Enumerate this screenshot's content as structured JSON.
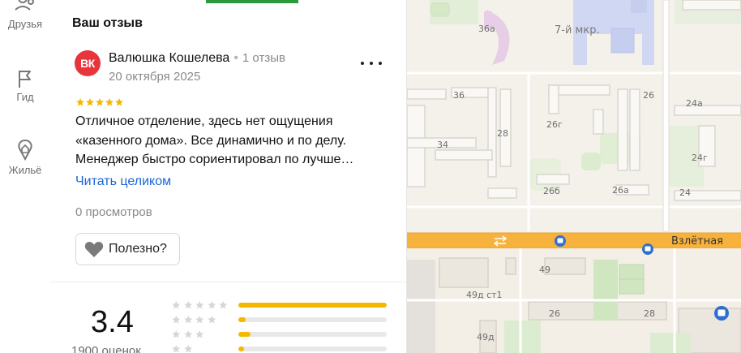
{
  "nav": {
    "items": [
      {
        "label": "Друзья",
        "icon": "friends-icon"
      },
      {
        "label": "Гид",
        "icon": "flag-icon"
      },
      {
        "label": "Жильё",
        "icon": "housing-icon"
      }
    ]
  },
  "review": {
    "section_title": "Ваш отзыв",
    "avatar_initials": "ВК",
    "avatar_color": "#e8343b",
    "author_name": "Валюшка Кошелева",
    "separator": "•",
    "author_reviews": "1 отзыв",
    "date": "20 октября 2025",
    "rating_stars": 5,
    "text": "Отличное отделение, здесь нет ощущения «казенного дома». Все динамично и по делу. Менеджер быстро сориентировал по лучше…",
    "read_more": "Читать целиком",
    "views": "0 просмотров",
    "helpful_label": "Полезно?"
  },
  "summary": {
    "rating": "3.4",
    "count_label": "1900 оценок",
    "distribution": [
      {
        "stars": 5,
        "fraction": 1.0
      },
      {
        "stars": 4,
        "fraction": 0.05
      },
      {
        "stars": 3,
        "fraction": 0.08
      },
      {
        "stars": 2,
        "fraction": 0.04
      }
    ]
  },
  "colors": {
    "accent_green": "#2c9a3a",
    "link_blue": "#1a66d8",
    "star_gold": "#f5b800",
    "star_grey": "#d6d6d6",
    "road_orange": "#f6b23d"
  },
  "map": {
    "district": "7-й мкр.",
    "street": "Взлётная",
    "labels": [
      "36а",
      "36",
      "28",
      "34",
      "26г",
      "26б",
      "26а",
      "26",
      "24а",
      "24г",
      "24",
      "49",
      "49д ст1",
      "26",
      "28",
      "49д"
    ]
  }
}
